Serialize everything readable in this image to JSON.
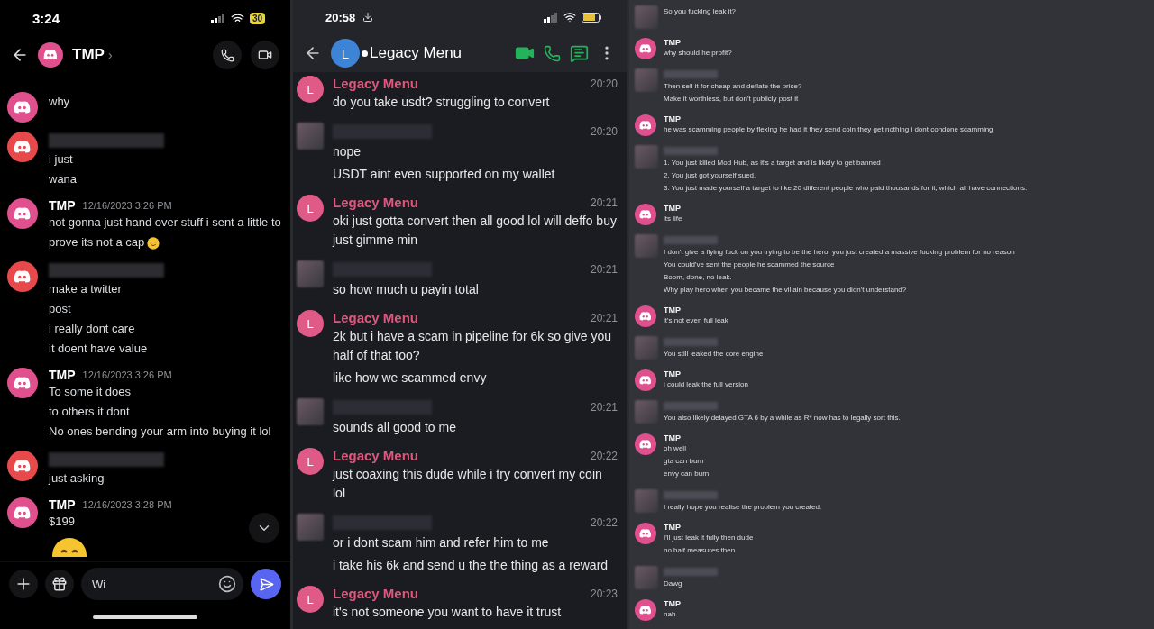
{
  "left_chat": {
    "status_bar": {
      "time": "3:24",
      "battery": "30"
    },
    "header": {
      "title": "TMP",
      "chevron": "›"
    },
    "messages": [
      {
        "kind": "tmp",
        "header_visible": false,
        "lines": [
          "why"
        ]
      },
      {
        "kind": "other",
        "header_visible": true,
        "lines": [
          "i just",
          "wana"
        ]
      },
      {
        "kind": "tmp",
        "header_visible": true,
        "name": "TMP",
        "timestamp": "12/16/2023 3:26 PM",
        "lines": [
          "not gonna just hand over stuff i sent a little to prove its not a cap"
        ],
        "trailing_emoji": true
      },
      {
        "kind": "other",
        "header_visible": true,
        "lines": [
          "make a twitter",
          "post",
          "i really dont care",
          "it doent have value"
        ]
      },
      {
        "kind": "tmp",
        "header_visible": true,
        "name": "TMP",
        "timestamp": "12/16/2023 3:26 PM",
        "lines": [
          "To some it does",
          "to others it dont",
          "No ones bending your arm into buying it lol"
        ]
      },
      {
        "kind": "other",
        "header_visible": true,
        "lines": [
          "just asking"
        ]
      },
      {
        "kind": "tmp",
        "header_visible": true,
        "name": "TMP",
        "timestamp": "12/16/2023 3:28 PM",
        "lines": [
          "$199"
        ],
        "big_emoji": true
      }
    ],
    "composer": {
      "value": "Wi"
    }
  },
  "middle_chat": {
    "status_bar": {
      "time": "20:58"
    },
    "header": {
      "avatar_letter": "L",
      "title": "Legacy Menu"
    },
    "messages": [
      {
        "kind": "member",
        "name": "Legacy Menu",
        "avatar_letter": "L",
        "time": "20:20",
        "lines": [
          "do you take usdt? struggling to convert"
        ]
      },
      {
        "kind": "other",
        "time": "20:20",
        "lines": [
          "nope",
          "USDT aint even supported on my wallet"
        ]
      },
      {
        "kind": "member",
        "name": "Legacy Menu",
        "avatar_letter": "L",
        "time": "20:21",
        "lines": [
          "oki just gotta convert then all good lol will deffo buy just gimme min"
        ]
      },
      {
        "kind": "other",
        "time": "20:21",
        "lines": [
          "so how much u payin total"
        ]
      },
      {
        "kind": "member",
        "name": "Legacy Menu",
        "avatar_letter": "L",
        "time": "20:21",
        "lines": [
          "2k but i have a scam in pipeline for 6k so give you half of that too?",
          "like how we scammed envy"
        ]
      },
      {
        "kind": "other",
        "time": "20:21",
        "lines": [
          "sounds all good to me"
        ]
      },
      {
        "kind": "member",
        "name": "Legacy Menu",
        "avatar_letter": "L",
        "time": "20:22",
        "lines": [
          "just coaxing this dude while i try convert my coin lol"
        ]
      },
      {
        "kind": "other",
        "time": "20:22",
        "lines": [
          "or i dont scam him and refer him to me",
          "i take his 6k and send u the the thing as a reward"
        ]
      },
      {
        "kind": "member",
        "name": "Legacy Menu",
        "avatar_letter": "L",
        "time": "20:23",
        "lines": [
          "it's not someone you want to have it trust"
        ]
      }
    ]
  },
  "right_chat": {
    "messages": [
      {
        "kind": "other",
        "header_visible": false,
        "lines": [
          "So you fucking leak it?"
        ]
      },
      {
        "kind": "tmp",
        "header_visible": true,
        "name": "TMP",
        "lines": [
          "why should he profit?"
        ]
      },
      {
        "kind": "other",
        "header_visible": true,
        "lines": [
          "Then sell it for cheap and deflate the price?",
          "Make it worthless, but don't publicly post it"
        ]
      },
      {
        "kind": "tmp",
        "header_visible": true,
        "name": "TMP",
        "lines": [
          "he was scamming people by flexing he had it they send coin they get nothing i dont condone scamming"
        ]
      },
      {
        "kind": "other",
        "header_visible": true,
        "lines": [
          "1. You just killed Mod Hub, as it's a target and is likely to get banned",
          "2. You just got yourself sued.",
          "3. You just made yourself a target to like 20 different people who paid thousands for it, which all have connections."
        ]
      },
      {
        "kind": "tmp",
        "header_visible": true,
        "name": "TMP",
        "lines": [
          "its life"
        ]
      },
      {
        "kind": "other",
        "header_visible": true,
        "lines": [
          "I don't give a flying fuck on you trying to be the hero, you just created a massive fucking problem for no reason",
          "You could've sent the people he scammed the source",
          "Boom, done, no leak.",
          "Why play hero when you became the villain because you didn't understand?"
        ]
      },
      {
        "kind": "tmp",
        "header_visible": true,
        "name": "TMP",
        "lines": [
          "it's not even full leak"
        ]
      },
      {
        "kind": "other",
        "header_visible": true,
        "lines": [
          "You still leaked the core engine"
        ]
      },
      {
        "kind": "tmp",
        "header_visible": true,
        "name": "TMP",
        "lines": [
          "i could leak the full version"
        ]
      },
      {
        "kind": "other",
        "header_visible": true,
        "lines": [
          "You also likely delayed GTA 6 by a while as R* now has to legally sort this."
        ]
      },
      {
        "kind": "tmp",
        "header_visible": true,
        "name": "TMP",
        "lines": [
          "oh well",
          "gta can burn",
          "envy can burn"
        ]
      },
      {
        "kind": "other",
        "header_visible": true,
        "lines": [
          "I really hope you realise the problem you created."
        ]
      },
      {
        "kind": "tmp",
        "header_visible": true,
        "name": "TMP",
        "lines": [
          "I'll just leak it fully then dude",
          "no half measures then"
        ]
      },
      {
        "kind": "other",
        "header_visible": true,
        "lines": [
          "Dawg"
        ]
      },
      {
        "kind": "tmp",
        "header_visible": true,
        "name": "TMP",
        "lines": [
          "nah"
        ]
      }
    ]
  }
}
